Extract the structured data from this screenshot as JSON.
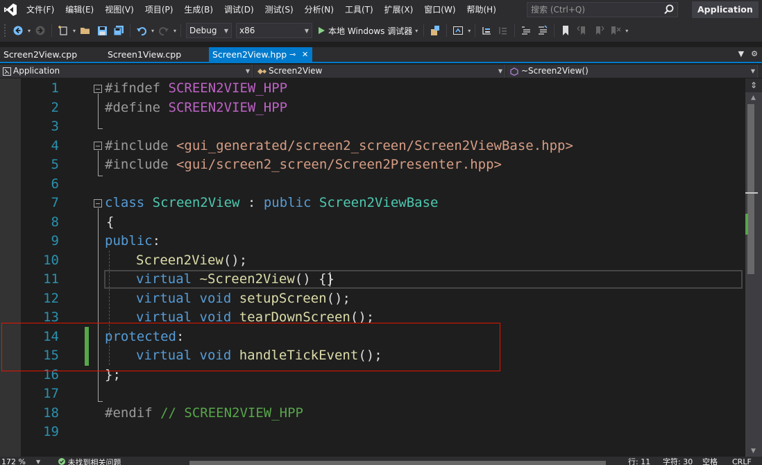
{
  "menubar": {
    "items": [
      "文件(F)",
      "编辑(E)",
      "视图(V)",
      "项目(P)",
      "生成(B)",
      "调试(D)",
      "测试(S)",
      "分析(N)",
      "工具(T)",
      "扩展(X)",
      "窗口(W)",
      "帮助(H)"
    ],
    "search_placeholder": "搜索 (Ctrl+Q)",
    "app_title": "Application"
  },
  "toolbar": {
    "config": "Debug",
    "platform": "x86",
    "run_label": "本地 Windows 调试器"
  },
  "tabs": [
    {
      "label": "Screen2View.cpp",
      "active": false
    },
    {
      "label": "Screen1View.cpp",
      "active": false
    },
    {
      "label": "Screen2View.hpp",
      "active": true
    }
  ],
  "tab_pin": "⊸",
  "tab_close": "✕",
  "navbar": {
    "project": "Application",
    "scope": "Screen2View",
    "member": "~Screen2View()"
  },
  "editor": {
    "line_numbers": [
      "1",
      "2",
      "3",
      "4",
      "5",
      "6",
      "7",
      "8",
      "9",
      "10",
      "11",
      "12",
      "13",
      "14",
      "15",
      "16",
      "17",
      "18",
      "19"
    ],
    "lines": {
      "l1": {
        "a": "#ifndef ",
        "b": "SCREEN2VIEW_HPP"
      },
      "l2": {
        "a": "#define ",
        "b": "SCREEN2VIEW_HPP"
      },
      "l4": {
        "a": "#include ",
        "b": "<gui_generated/screen2_screen/Screen2ViewBase.hpp>"
      },
      "l5": {
        "a": "#include ",
        "b": "<gui/screen2_screen/Screen2Presenter.hpp>"
      },
      "l7": {
        "a": "class ",
        "b": "Screen2View",
        "c": " : ",
        "d": "public ",
        "e": "Screen2ViewBase"
      },
      "l8": {
        "a": "{"
      },
      "l9": {
        "a": "public",
        "b": ":"
      },
      "l10": {
        "a": "Screen2View",
        "b": "();"
      },
      "l11": {
        "a": "virtual ",
        "b": "~Screen2View",
        "c": "() {}"
      },
      "l12": {
        "a": "virtual ",
        "b": "void ",
        "c": "setupScreen",
        "d": "();"
      },
      "l13": {
        "a": "virtual ",
        "b": "void ",
        "c": "tearDownScreen",
        "d": "();"
      },
      "l14": {
        "a": "protected",
        "b": ":"
      },
      "l15": {
        "a": "virtual ",
        "b": "void ",
        "c": "handleTickEvent",
        "d": "();"
      },
      "l16": {
        "a": "};"
      },
      "l18": {
        "a": "#endif ",
        "b": "// SCREEN2VIEW_HPP"
      }
    }
  },
  "statusbar": {
    "zoom": "172 %",
    "issues": "未找到相关问题",
    "line": "行: 11",
    "char": "字符: 30",
    "mode": "空格",
    "eol": "CRLF"
  },
  "colors": {
    "accent": "#007acc",
    "keyword": "#569cd6",
    "type": "#4ec9b0",
    "macro": "#bd63c5",
    "string": "#d69d85",
    "function": "#dcdcaa",
    "comment": "#57a64a",
    "line_number": "#2b91af",
    "annotation_box": "#e51400"
  }
}
